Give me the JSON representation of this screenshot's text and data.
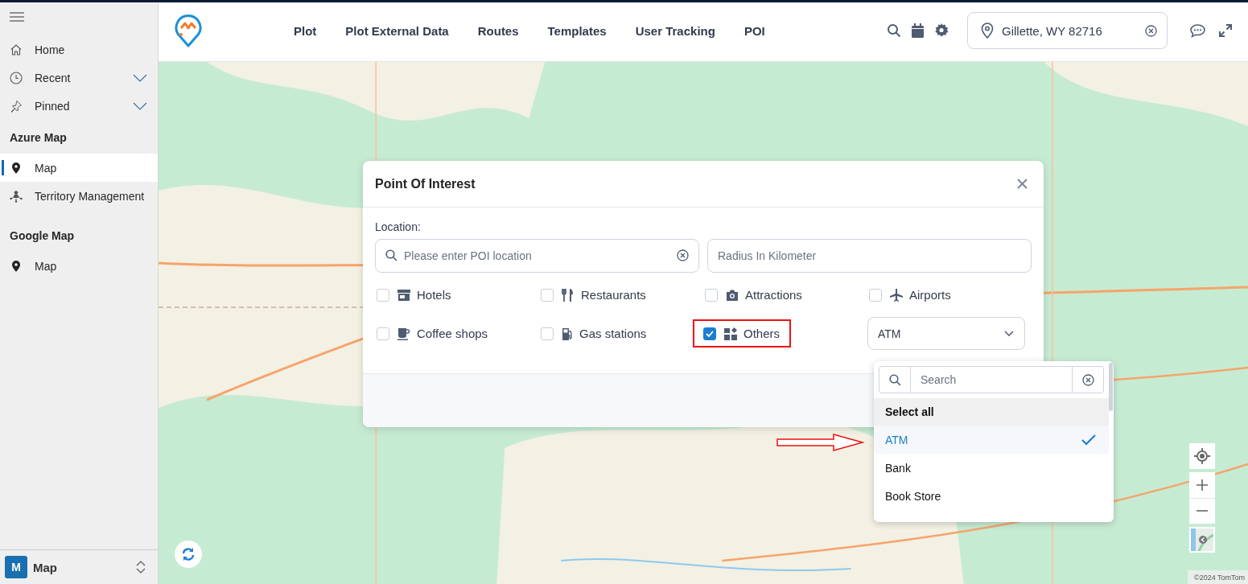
{
  "sidebar": {
    "items": [
      {
        "label": "Home",
        "expandable": false
      },
      {
        "label": "Recent",
        "expandable": true
      },
      {
        "label": "Pinned",
        "expandable": true
      }
    ],
    "sections": [
      {
        "title": "Azure Map",
        "items": [
          {
            "label": "Map",
            "selected": true
          },
          {
            "label": "Territory Management",
            "selected": false
          }
        ]
      },
      {
        "title": "Google Map",
        "items": [
          {
            "label": "Map",
            "selected": false
          }
        ]
      }
    ],
    "footer": {
      "badge": "M",
      "label": "Map"
    }
  },
  "nav": {
    "links": [
      "Plot",
      "Plot External Data",
      "Routes",
      "Templates",
      "User Tracking",
      "POI"
    ]
  },
  "location_field": {
    "value": "Gillette, WY 82716"
  },
  "dialog": {
    "title": "Point Of Interest",
    "location_label": "Location:",
    "location_field": {
      "placeholder": "Please enter POI location"
    },
    "radius_field": {
      "placeholder": "Radius In Kilometer"
    },
    "categories": [
      {
        "label": "Hotels",
        "checked": false,
        "highlighted": false
      },
      {
        "label": "Restaurants",
        "checked": false,
        "highlighted": false
      },
      {
        "label": "Attractions",
        "checked": false,
        "highlighted": false
      },
      {
        "label": "Airports",
        "checked": false,
        "highlighted": false
      },
      {
        "label": "Coffee shops",
        "checked": false,
        "highlighted": false
      },
      {
        "label": "Gas stations",
        "checked": false,
        "highlighted": false
      },
      {
        "label": "Others",
        "checked": true,
        "highlighted": true
      }
    ],
    "type_select": {
      "value": "ATM"
    },
    "dropdown": {
      "search_placeholder": "Search",
      "select_all": "Select all",
      "options": [
        {
          "label": "ATM",
          "selected": true
        },
        {
          "label": "Bank",
          "selected": false
        },
        {
          "label": "Book Store",
          "selected": false
        }
      ]
    }
  },
  "map": {
    "attribution": "©2024 TomTom"
  }
}
